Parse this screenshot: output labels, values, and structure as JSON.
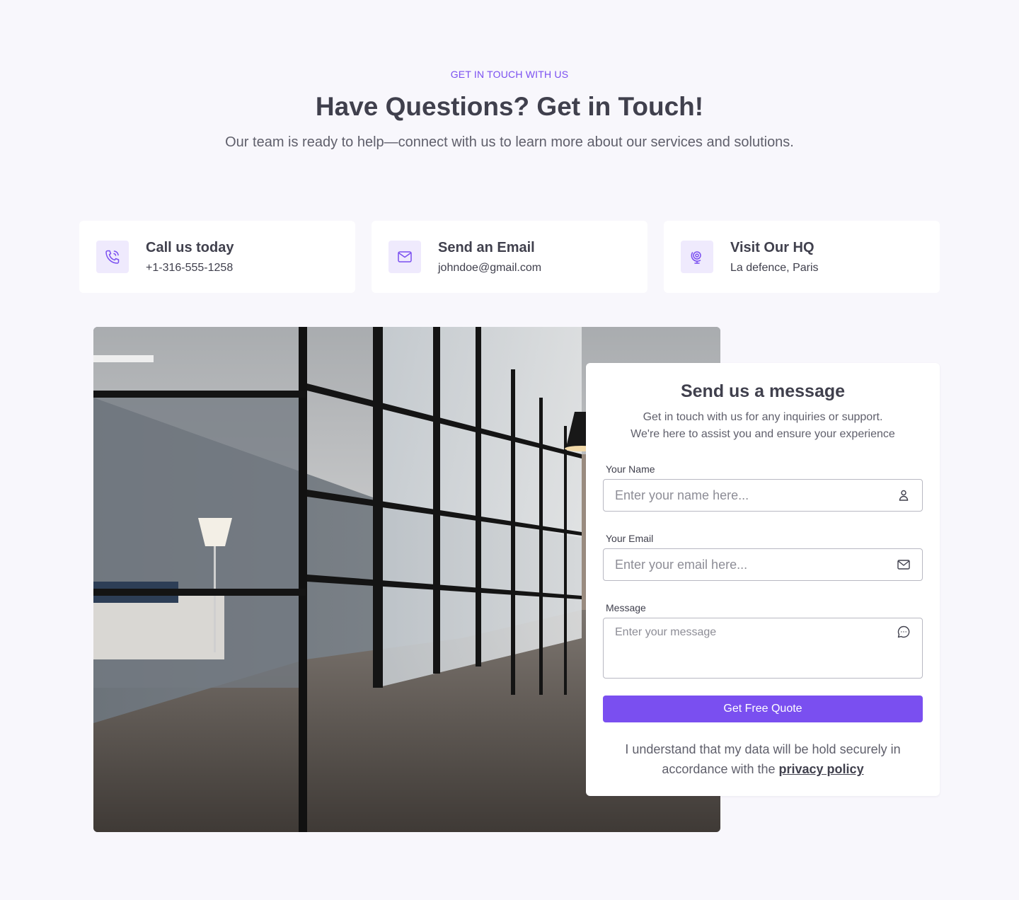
{
  "header": {
    "eyebrow": "GET IN TOUCH WITH US",
    "title": "Have Questions? Get in Touch!",
    "subtitle": "Our team is ready to help—connect with us to learn more about our services and solutions."
  },
  "contact_cards": [
    {
      "icon": "phone-icon",
      "title": "Call us today",
      "value": "+1-316-555-1258"
    },
    {
      "icon": "mail-icon",
      "title": "Send an Email",
      "value": "johndoe@gmail.com"
    },
    {
      "icon": "globe-icon",
      "title": "Visit Our HQ",
      "value": "La defence, Paris"
    }
  ],
  "form": {
    "title": "Send us a message",
    "description_line1": "Get in touch with us for any inquiries or support.",
    "description_line2": "We're here to assist you and ensure your experience",
    "name_label": "Your Name",
    "name_placeholder": "Enter your name here...",
    "email_label": "Your Email",
    "email_placeholder": "Enter your email here...",
    "message_label": "Message",
    "message_placeholder": "Enter your message",
    "submit_label": "Get Free Quote",
    "legal_line1": "I understand that my data will be hold securely in",
    "legal_line2_prefix": "accordance with the",
    "privacy_link": "privacy policy"
  },
  "colors": {
    "accent": "#7a4ff0",
    "background": "#f8f7fc",
    "icon_tint": "#efeafd"
  }
}
